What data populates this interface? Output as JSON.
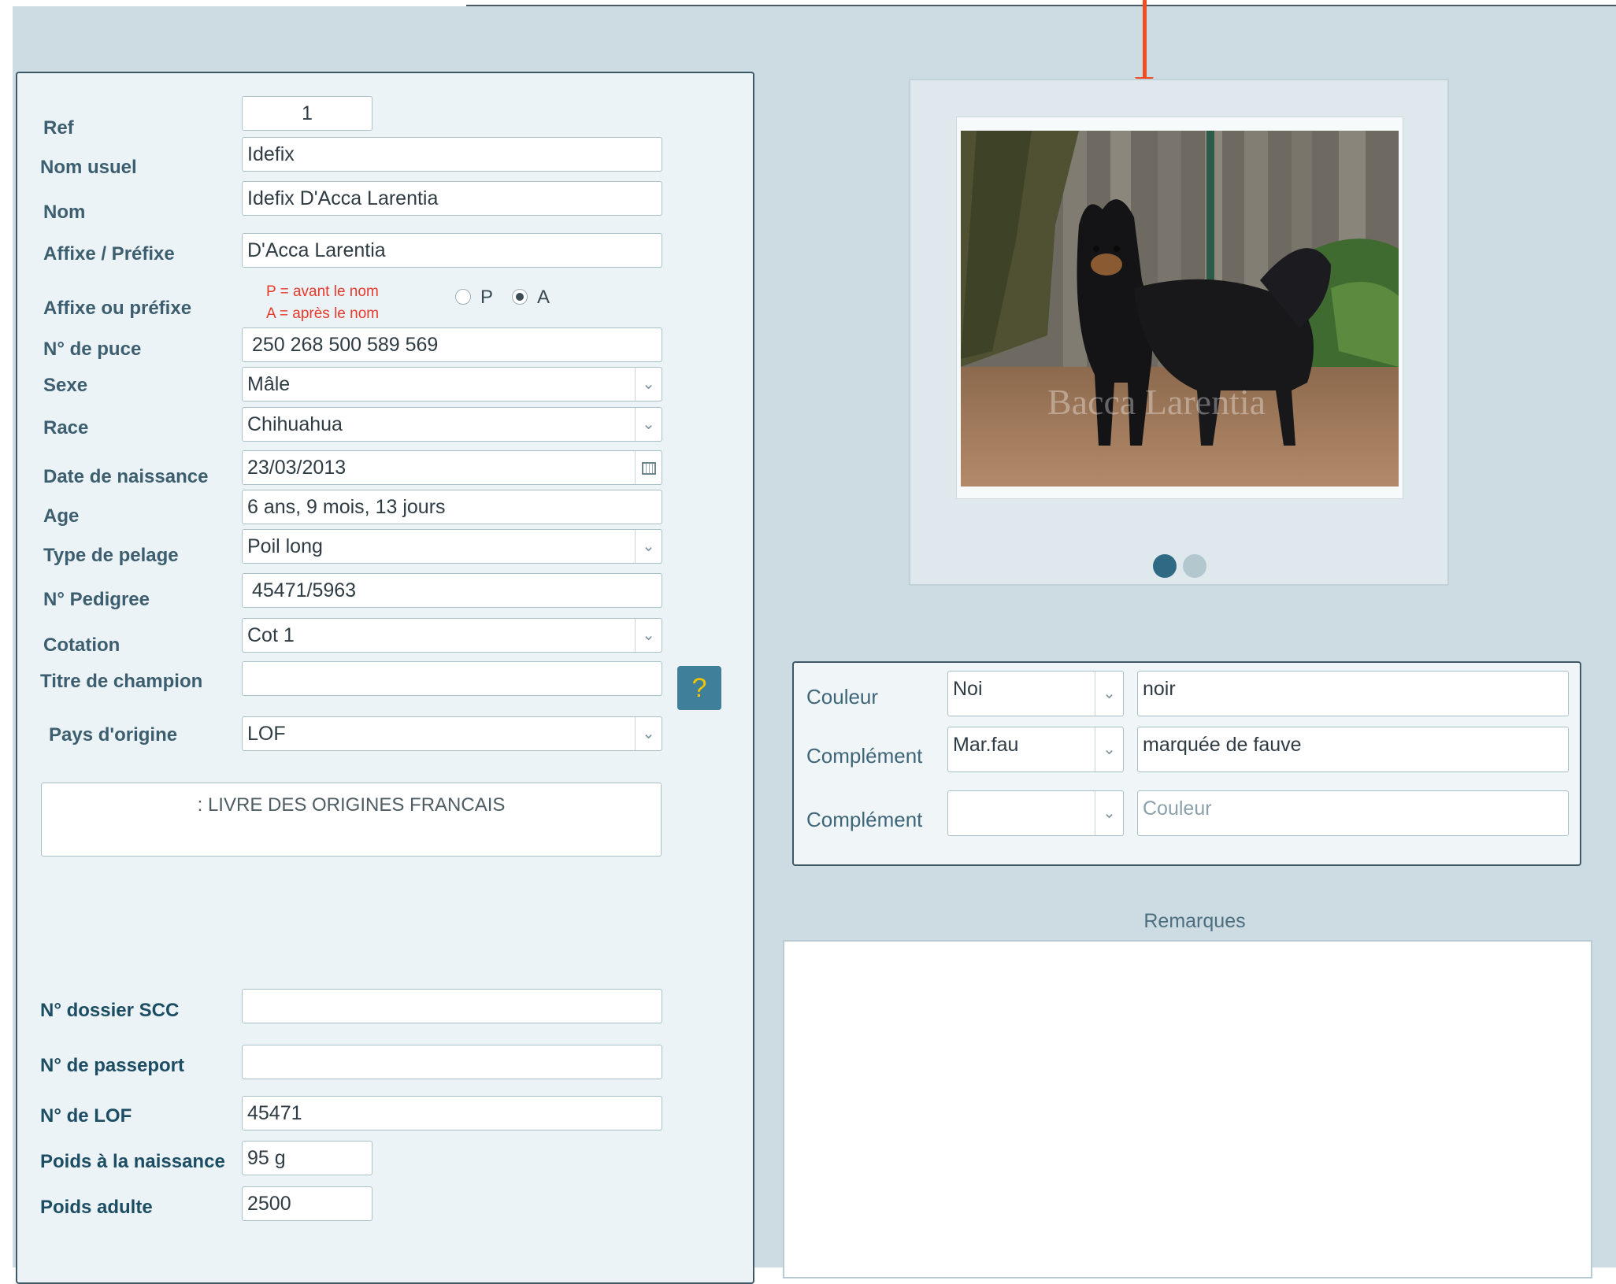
{
  "identity": {
    "ref_label": "Ref",
    "ref_value": "1",
    "nom_usuel_label": "Nom usuel",
    "nom_usuel_value": "Idefix",
    "nom_label": "Nom",
    "nom_value": "Idefix  D'Acca Larentia",
    "affixe_label": "Affixe / Préfixe",
    "affixe_value": "D'Acca Larentia",
    "affixe_ou_prefixe_label": "Affixe ou préfixe",
    "hint_p": "P = avant le nom",
    "hint_a": "A = après le nom",
    "radio_p_label": "P",
    "radio_a_label": "A",
    "radio_selected": "A",
    "puce_label": "N° de puce",
    "puce_value": "250 268 500 589 569",
    "sexe_label": "Sexe",
    "sexe_value": "Mâle",
    "race_label": "Race",
    "race_value": "Chihuahua",
    "naissance_label": "Date de naissance",
    "naissance_value": "23/03/2013",
    "age_label": "Age",
    "age_value": "6 ans, 9 mois, 13 jours",
    "pelage_label": "Type de pelage",
    "pelage_value": "Poil long",
    "pedigree_label": "N° Pedigree",
    "pedigree_value": "45471/5963",
    "cotation_label": "Cotation",
    "cotation_value": "Cot 1",
    "titre_label": "Titre de champion",
    "titre_value": "",
    "help_label": "?",
    "pays_label": "Pays d'origine",
    "pays_value": "LOF",
    "origin_description": ": LIVRE DES ORIGINES FRANCAIS"
  },
  "records": {
    "scc_label": "N° dossier SCC",
    "scc_value": "",
    "passeport_label": "N° de passeport",
    "passeport_value": "",
    "lof_label": "N° de LOF",
    "lof_value": "45471",
    "poids_naissance_label": "Poids à la naissance",
    "poids_naissance_value": "95 g",
    "poids_adulte_label": "Poids adulte",
    "poids_adulte_value": "2500"
  },
  "photo": {
    "watermark": "Bacca Larentia",
    "carousel_count": 2,
    "carousel_active": 1
  },
  "colors": {
    "couleur_label": "Couleur",
    "couleur_code": "Noi",
    "couleur_desc": "noir",
    "complement1_label": "Complément",
    "complement1_code": "Mar.fau",
    "complement1_desc": "marquée de fauve",
    "complement2_label": "Complément",
    "complement2_code": "",
    "complement2_placeholder": "Couleur"
  },
  "remarks": {
    "title": "Remarques",
    "value": ""
  },
  "theme": {
    "background": "#cddce2",
    "panel": "#ebf3f6",
    "border": "#3e5866",
    "label": "#3c5e6f",
    "hint_red": "#e53a2c",
    "help_button": "#3f7f9a",
    "annotation_arrow": "#f04e23"
  }
}
